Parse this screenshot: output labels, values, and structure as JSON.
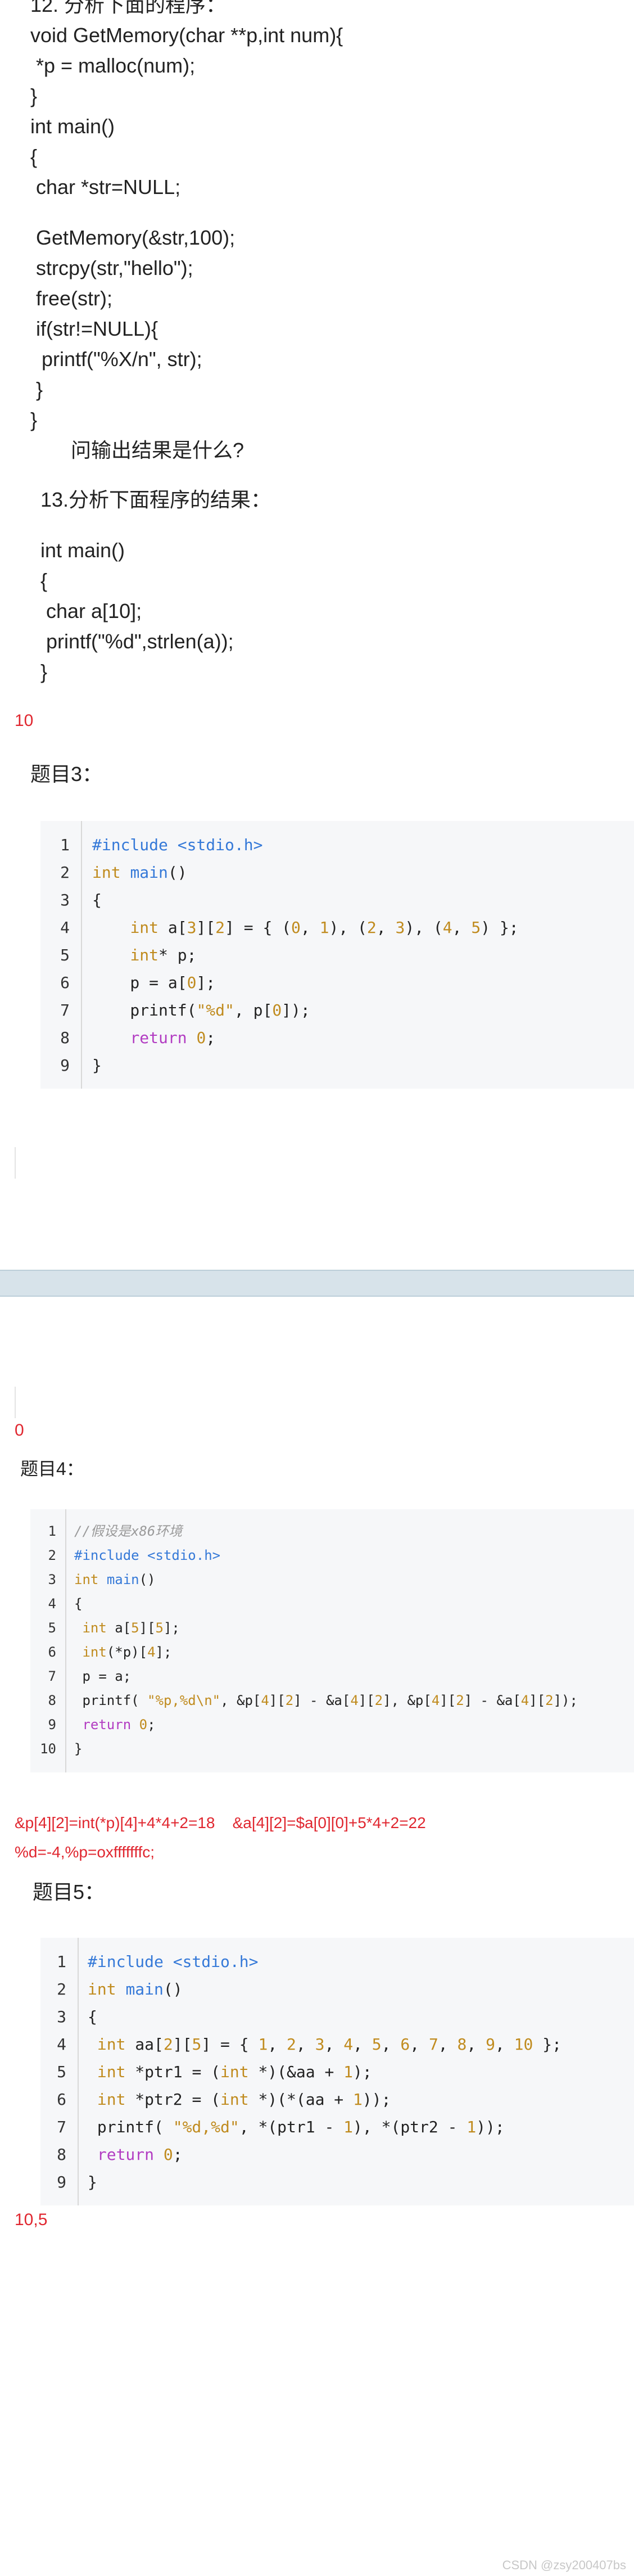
{
  "q12": {
    "title": "12. 分析下面的程序：",
    "lines": [
      "void GetMemory(char **p,int num){",
      " *p = malloc(num);",
      "}",
      "int main()",
      "{",
      " char *str=NULL;",
      "",
      " GetMemory(&str,100);",
      " strcpy(str,\"hello\");",
      " free(str);",
      " if(str!=NULL){",
      "  printf(\"%X/n\", str);",
      " }",
      "}"
    ],
    "question": "问输出结果是什么?"
  },
  "q13": {
    "title": "13.分析下面程序的结果：",
    "lines": [
      "int main()",
      "{",
      " char a[10];",
      " printf(\"%d\",strlen(a));",
      "}"
    ],
    "answer": "10"
  },
  "t3": {
    "title": "题目3：",
    "line_numbers": [
      "1",
      "2",
      "3",
      "4",
      "5",
      "6",
      "7",
      "8",
      "9"
    ],
    "answer": "0"
  },
  "t4": {
    "title": "题目4：",
    "line_numbers": [
      "1",
      "2",
      "3",
      "4",
      "5",
      "6",
      "7",
      "8",
      "9",
      "10"
    ],
    "answer_line1": "&p[4][2]=int(*p)[4]+4*4+2=18    &a[4][2]=$a[0][0]+5*4+2=22",
    "answer_line2": "%d=-4,%p=oxfffffffc;"
  },
  "t5": {
    "title": "题目5：",
    "line_numbers": [
      "1",
      "2",
      "3",
      "4",
      "5",
      "6",
      "7",
      "8",
      "9"
    ],
    "answer": "10,5"
  },
  "watermark": "CSDN @zsy200407bs",
  "colors": {
    "answer_red": "#e0262f",
    "code_bg": "#f6f7f9",
    "separator_band": "#d7e3ea"
  }
}
